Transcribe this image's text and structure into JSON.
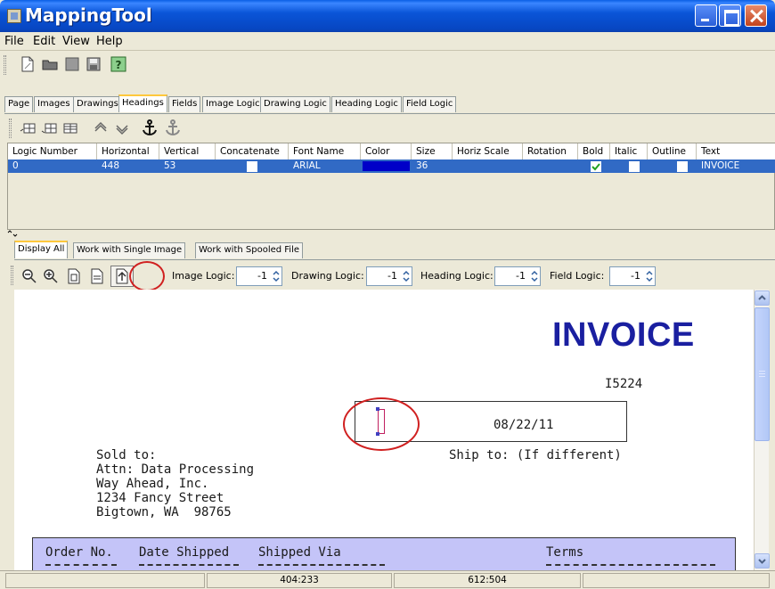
{
  "window": {
    "title": "MappingTool"
  },
  "menu": [
    "File",
    "Edit",
    "View",
    "Help"
  ],
  "top_tabs": [
    "Page",
    "Images",
    "Drawings",
    "Headings",
    "Fields",
    "Image Logic",
    "Drawing Logic",
    "Heading Logic",
    "Field Logic"
  ],
  "active_top_tab": "Headings",
  "table": {
    "columns": [
      "Logic Number",
      "Horizontal",
      "Vertical",
      "Concatenate",
      "Font Name",
      "Color",
      "Size",
      "Horiz Scale",
      "Rotation",
      "Bold",
      "Italic",
      "Outline",
      "Text"
    ],
    "row": {
      "logic_number": "0",
      "horizontal": "448",
      "vertical": "53",
      "concatenate": false,
      "font_name": "ARIAL",
      "color": "#0000c8",
      "size": "36",
      "horiz_scale": "",
      "rotation": "",
      "bold": true,
      "italic": false,
      "outline": false,
      "text": "INVOICE"
    }
  },
  "bottom_tabs": [
    "Display All",
    "Work with Single Image",
    "Work with Spooled File"
  ],
  "active_bottom_tab": "Display All",
  "logic_controls": [
    {
      "label": "Image Logic:",
      "value": "-1"
    },
    {
      "label": "Drawing Logic:",
      "value": "-1"
    },
    {
      "label": "Heading Logic:",
      "value": "-1"
    },
    {
      "label": "Field Logic:",
      "value": "-1"
    }
  ],
  "document": {
    "heading": "INVOICE",
    "invoice_number": "I5224",
    "date": "08/22/11",
    "sold_to_label": "Sold to:",
    "address": [
      "Attn: Data Processing",
      "Way Ahead, Inc.",
      "1234 Fancy Street",
      "Bigtown, WA  98765"
    ],
    "ship_to_label": "Ship to: (If different)",
    "table_headers": [
      "Order No.",
      "Date Shipped",
      "Shipped Via",
      "Terms"
    ]
  },
  "status": {
    "left": "",
    "coord1": "404:233",
    "coord2": "612:504",
    "right": ""
  },
  "colors": {
    "title_bar": "#0a55d8",
    "selection": "#316ac5",
    "invoice_blue": "#1a1fa0",
    "annotation_red": "#d02020"
  },
  "icons": [
    "new-document-icon",
    "open-folder-icon",
    "save-icon",
    "save-as-icon",
    "help-icon",
    "insert-row-before-icon",
    "insert-row-after-icon",
    "delete-row-icon",
    "move-up-icon",
    "move-down-icon",
    "anchor-icon",
    "anchor-disabled-icon",
    "zoom-out-icon",
    "zoom-in-icon",
    "fit-page-icon",
    "fit-width-icon",
    "upload-icon"
  ]
}
